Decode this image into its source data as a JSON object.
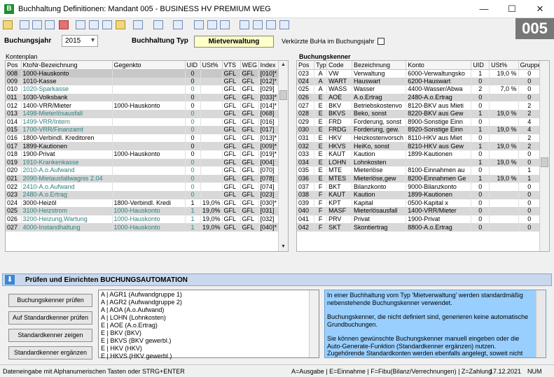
{
  "window": {
    "title": "Buchhaltung Definitionen: Mandant 005 - BUSINESS HV PREMIUM WEG",
    "app_letter": "B",
    "min": "—",
    "max": "☐",
    "close": "✕"
  },
  "mandant": "005",
  "header": {
    "year_label": "Buchungsjahr",
    "year_value": "2015",
    "type_label": "Buchhaltung Typ",
    "type_value": "Mietverwaltung",
    "short_label": "Verkürzte BuHa im Buchungsjahr"
  },
  "konten": {
    "title": "Kontenplan",
    "columns": [
      "Pos",
      "KtoNr-Bezeichnung",
      "Gegenkto",
      "UID",
      "USt%",
      "VTS",
      "WEG",
      "Index"
    ],
    "rows": [
      [
        "008",
        "1000-Hauskonto",
        "",
        "0",
        "",
        "GFL",
        "GFL",
        "[010]*"
      ],
      [
        "009",
        "1010-Kasse",
        "",
        "0",
        "",
        "GFL",
        "GFL",
        "[012]*"
      ],
      [
        "010",
        "1020-Sparkasse",
        "",
        "0",
        "",
        "GFL",
        "GFL",
        "[029]"
      ],
      [
        "011",
        "1030-Volksbank",
        "",
        "0",
        "",
        "GFL",
        "GFL",
        "[033]*"
      ],
      [
        "012",
        "1400-VRR/Mieter",
        "1000-Hauskonto",
        "0",
        "",
        "GFL",
        "GFL",
        "[014]*"
      ],
      [
        "013",
        "1498-Mieterlösausfall",
        "",
        "0",
        "",
        "GFL",
        "GFL",
        "[068]"
      ],
      [
        "014",
        "1499-VRR/Intern",
        "",
        "0",
        "",
        "GFL",
        "GFL",
        "[016]"
      ],
      [
        "015",
        "1700-VRR/Finanzamt",
        "",
        "0",
        "",
        "GFL",
        "GFL",
        "[017]"
      ],
      [
        "016",
        "1800-Verbindl. Kreditoren",
        "",
        "0",
        "",
        "GFL",
        "GFL",
        "[013]*"
      ],
      [
        "017",
        "1899-Kautionen",
        "",
        "0",
        "",
        "GFL",
        "GFL",
        "[009]*"
      ],
      [
        "018",
        "1900-Privat",
        "1000-Hauskonto",
        "0",
        "",
        "GFL",
        "GFL",
        "[019]*"
      ],
      [
        "019",
        "1910-Krankenkasse",
        "",
        "0",
        "",
        "GFL",
        "GFL",
        "[004]"
      ],
      [
        "020",
        "2010-A.o.Aufwand",
        "",
        "0",
        "",
        "GFL",
        "GFL",
        "[070]"
      ],
      [
        "021",
        "2090-Mietausfallwagnis 2.04",
        "",
        "0",
        "",
        "GFL",
        "GFL",
        "[078]"
      ],
      [
        "022",
        "2410-A.o.Aufwand",
        "",
        "0",
        "",
        "GFL",
        "GFL",
        "[074]"
      ],
      [
        "023",
        "2480-A.o.Ertrag",
        "",
        "0",
        "",
        "GFL",
        "GFL",
        "[023]"
      ],
      [
        "024",
        "3000-Heizöl",
        "1800-Verbindl. Kredi",
        "1",
        "19,0%",
        "GFL",
        "GFL",
        "[030]*"
      ],
      [
        "025",
        "3100-Heizstrom",
        "1000-Hauskonto",
        "1",
        "19,0%",
        "GFL",
        "GFL",
        "[031]"
      ],
      [
        "026",
        "3200-Heizung,Wartung",
        "1000-Hauskonto",
        "1",
        "19,0%",
        "GFL",
        "GFL",
        "[032]"
      ],
      [
        "027",
        "4000-Instandhaltung",
        "1000-Hauskonto",
        "1",
        "19,0%",
        "GFL",
        "GFL",
        "[040]*"
      ]
    ]
  },
  "kenner": {
    "title": "Buchungskenner",
    "columns": [
      "Pos",
      "Typ",
      "Code",
      "Bezeichnung",
      "Konto",
      "UID",
      "USt%",
      "Gruppe"
    ],
    "rows": [
      [
        "023",
        "A",
        "VW",
        "Verwaltung",
        "6000-Verwaltungsko",
        "1",
        "19,0 %",
        "0"
      ],
      [
        "024",
        "A",
        "WART",
        "Hauswart",
        "6200-Hauswart",
        "0",
        "",
        "0"
      ],
      [
        "025",
        "A",
        "WASS",
        "Wasser",
        "4400-Wasser/Abwa",
        "2",
        "7,0 %",
        "0"
      ],
      [
        "026",
        "E",
        "AOE",
        "A.o.Ertrag",
        "2480-A.o.Ertrag",
        "0",
        "",
        "0"
      ],
      [
        "027",
        "E",
        "BKV",
        "Betriebskostenvo",
        "8120-BKV aus Mieti",
        "0",
        "",
        "2"
      ],
      [
        "028",
        "E",
        "BKVS",
        "Beko, sonst",
        "8220-BKV aus Gew",
        "1",
        "19,0 %",
        "2"
      ],
      [
        "029",
        "E",
        "FRD",
        "Forderung, sonst",
        "8900-Sonstige Einn",
        "0",
        "",
        "4"
      ],
      [
        "030",
        "E",
        "FRDG",
        "Forderung, gew.",
        "8920-Sonstige Einn",
        "1",
        "19,0 %",
        "4"
      ],
      [
        "031",
        "E",
        "HKV",
        "Heizkostenvorsch",
        "8110-HKV aus Miet",
        "0",
        "",
        "2"
      ],
      [
        "032",
        "E",
        "HKVS",
        "HeiKo, sonst",
        "8210-HKV aus Gew",
        "1",
        "19,0 %",
        "2"
      ],
      [
        "033",
        "E",
        "KAUT",
        "Kaution",
        "1899-Kautionen",
        "0",
        "",
        "0"
      ],
      [
        "034",
        "E",
        "LOHN",
        "Lohnkosten",
        "",
        "1",
        "19,0 %",
        "0"
      ],
      [
        "035",
        "E",
        "MTE",
        "Mieterlöse",
        "8100-Einnahmen au",
        "0",
        "",
        "1"
      ],
      [
        "036",
        "E",
        "MTES",
        "Mieterlöse,gew",
        "8200-Einnahmen Ge",
        "1",
        "19,0 %",
        "1"
      ],
      [
        "037",
        "F",
        "BKT",
        "Bilanzkonto",
        "9000-Bilanzkonto",
        "0",
        "",
        "0"
      ],
      [
        "038",
        "F",
        "KAUT",
        "Kaution",
        "1899-Kautionen",
        "0",
        "",
        "0"
      ],
      [
        "039",
        "F",
        "KPT",
        "Kapital",
        "0500-Kapital x",
        "0",
        "",
        "0"
      ],
      [
        "040",
        "F",
        "MASF",
        "Mieterlösausfall",
        "1400-VRR/Mieter",
        "0",
        "",
        "0"
      ],
      [
        "041",
        "F",
        "PRV",
        "Privat",
        "1900-Privat",
        "0",
        "",
        "0"
      ],
      [
        "042",
        "F",
        "SKT",
        "Skontiertrag",
        "8800-A.o.Ertrag",
        "0",
        "",
        "0"
      ]
    ]
  },
  "automation": {
    "title": "Prüfen und Einrichten BUCHUNGSAUTOMATION",
    "buttons": [
      "Buchungskenner prüfen",
      "Auf Standardkenner prüfen",
      "Standardkenner zeigen",
      "Standardkenner ergänzen"
    ],
    "list": [
      "A | AGR1 (Aufwandgruppe 1)",
      "A | AGR2 (Aufwandgruppe 2)",
      "A | AOA (A.o.Aufwand)",
      "A | LOHN (Lohnkosten)",
      "E | AOE (A.o.Ertrag)",
      "E | BKV (BKV)",
      "E | BKVS (BKV  gewerbl.)",
      "E | HKV (HKV)",
      "E | HKVS (HKV  gewerbl.)"
    ],
    "info": [
      "In einer Buchhaltung vom Typ 'Mietverwaltung' werden standardmäßig nebenstehende Buchungskenner verwendet.",
      "Buchungskenner, die nicht definiert sind, generieren keine automatische Grundbuchungen.",
      "Sie können gewünschte Buchungskenner manuell eingeben oder die Auto-Generate-Funktion (Standardkenner ergänzen) nutzen. Zugehörende Standardkonten werden ebenfalls angelegt, soweit nicht vorhanden."
    ]
  },
  "status": {
    "left": "Dateneingabe mit Alphanumerischen Tasten oder STRG+ENTER",
    "legend": "A=Ausgabe | E=Einnahme | F=Fibu(Bilanz/Verrechnungen) | Z=Zahlung",
    "date": "17.12.2021",
    "num": "NUM"
  },
  "colors": {
    "green_text": "#2f7f7f",
    "info_bg": "#99cfff",
    "mandant_bg": "#777777",
    "type_bg": "#ffffc8"
  }
}
